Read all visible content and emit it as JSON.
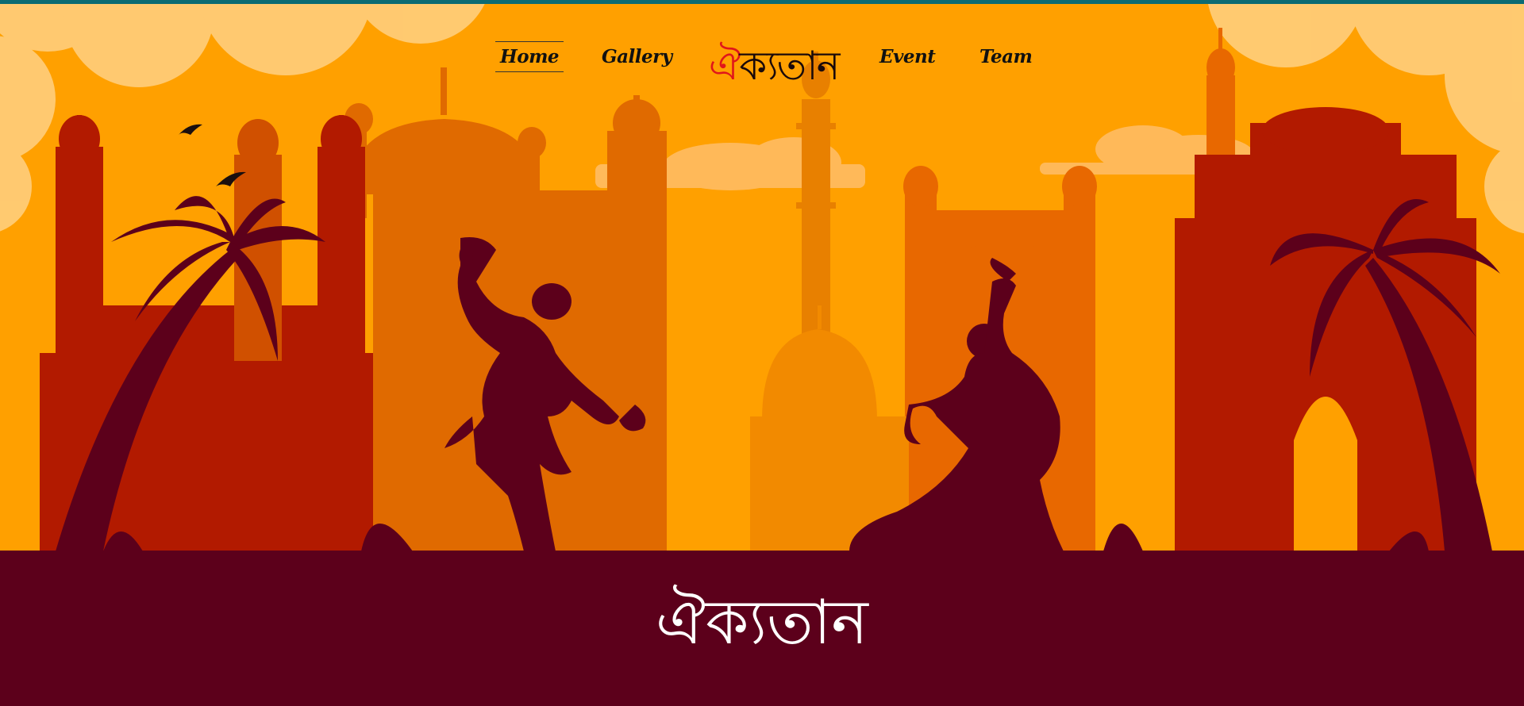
{
  "nav": {
    "items": [
      {
        "label": "Home",
        "active": true
      },
      {
        "label": "Gallery",
        "active": false
      },
      {
        "label": "Event",
        "active": false
      },
      {
        "label": "Team",
        "active": false
      }
    ],
    "logo_first": "ঐ",
    "logo_rest": "ক্যতান"
  },
  "hero": {
    "title": "ঐক্যতান"
  },
  "colors": {
    "top_strip": "#0b6b73",
    "sky": "#ffa000",
    "monument_dark": "#b21a00",
    "silhouette": "#5c001b",
    "footer_band": "#5c001b",
    "logo_accent": "#e0161a"
  },
  "icons": [
    "bird-icon",
    "dancer-silhouette",
    "palm-tree-silhouette",
    "india-gate-silhouette",
    "mosque-silhouette"
  ]
}
